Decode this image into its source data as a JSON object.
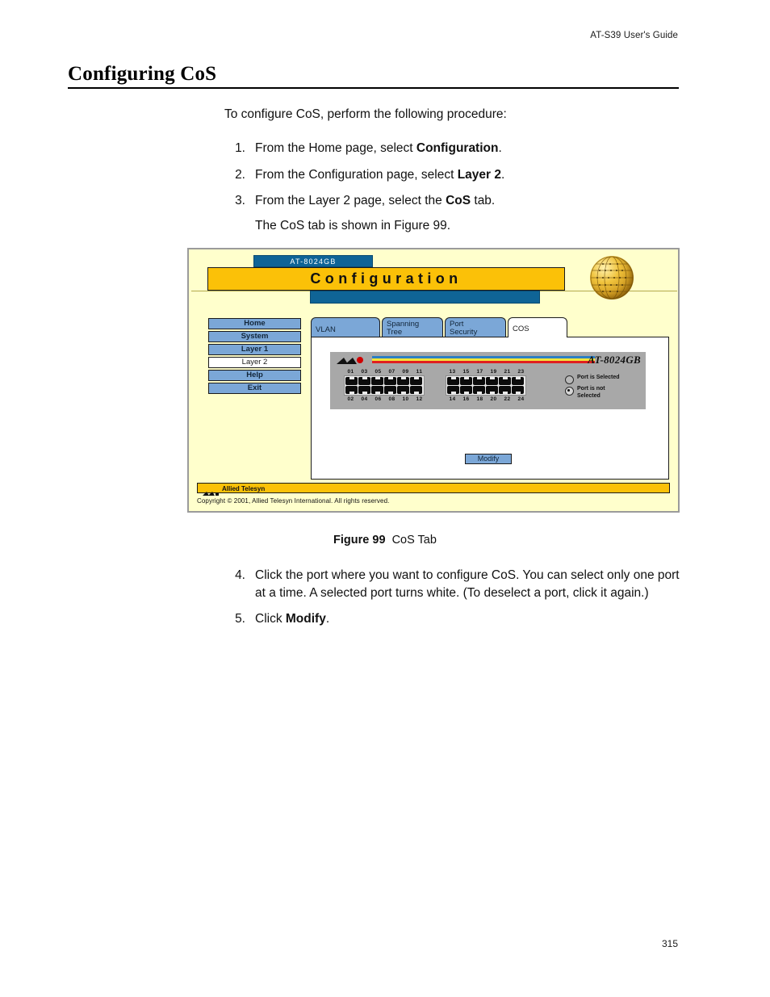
{
  "header": {
    "running_head": "AT-S39 User's Guide"
  },
  "page": {
    "title": "Configuring CoS",
    "number": "315"
  },
  "body": {
    "intro": "To configure CoS, perform the following procedure:",
    "steps_before": [
      {
        "num": "1.",
        "pre": "From the Home page, select ",
        "bold": "Configuration",
        "post": "."
      },
      {
        "num": "2.",
        "pre": "From the Configuration page, select ",
        "bold": "Layer 2",
        "post": "."
      },
      {
        "num": "3.",
        "pre": "From the Layer 2 page, select the ",
        "bold": "CoS",
        "post": " tab."
      }
    ],
    "substep": "The CoS tab is shown in Figure 99.",
    "steps_after": [
      {
        "num": "4.",
        "pre": "Click the port where you want to configure CoS. You can select only one port at a time. A selected port turns white. (To deselect a port, click it again.)",
        "bold": "",
        "post": ""
      },
      {
        "num": "5.",
        "pre": "Click ",
        "bold": "Modify",
        "post": "."
      }
    ]
  },
  "caption": {
    "label": "Figure 99",
    "text": "CoS Tab"
  },
  "figure": {
    "device_tab": "AT-8024GB",
    "banner_title": "Configuration",
    "sidebar": [
      {
        "label": "Home",
        "selected": false
      },
      {
        "label": "System",
        "selected": false
      },
      {
        "label": "Layer 1",
        "selected": false
      },
      {
        "label": "Layer 2",
        "selected": true
      },
      {
        "label": "Help",
        "selected": false
      },
      {
        "label": "Exit",
        "selected": false
      }
    ],
    "tabs": [
      {
        "label": "VLAN",
        "active": false
      },
      {
        "label": "Spanning\nTree",
        "line1": "Spanning",
        "line2": "Tree",
        "active": false
      },
      {
        "label": "Port\nSecurity",
        "line1": "Port",
        "line2": "Security",
        "active": false
      },
      {
        "label": "COS",
        "active": true
      }
    ],
    "switch": {
      "model": "AT-8024GB",
      "ports_top_left": [
        "01",
        "03",
        "05",
        "07",
        "09",
        "11"
      ],
      "ports_bottom_left": [
        "02",
        "04",
        "06",
        "08",
        "10",
        "12"
      ],
      "ports_top_right": [
        "13",
        "15",
        "17",
        "19",
        "21",
        "23"
      ],
      "ports_bottom_right": [
        "14",
        "16",
        "18",
        "20",
        "22",
        "24"
      ]
    },
    "legend": [
      {
        "label": "Port is Selected",
        "selected": false
      },
      {
        "label": "Port is not Selected",
        "line1": "Port is not",
        "line2": "Selected",
        "selected": true
      }
    ],
    "modify_button": "Modify",
    "footer_brand": "Allied Telesyn",
    "copyright": "Copyright © 2001, Allied Telesyn International. All rights reserved."
  },
  "colors": {
    "banner_yellow": "#FBC108",
    "page_yellow": "#FFFFCC",
    "button_blue": "#7BA7D7",
    "tab_blue": "#0F6496",
    "device_gray": "#A8A8A8"
  }
}
